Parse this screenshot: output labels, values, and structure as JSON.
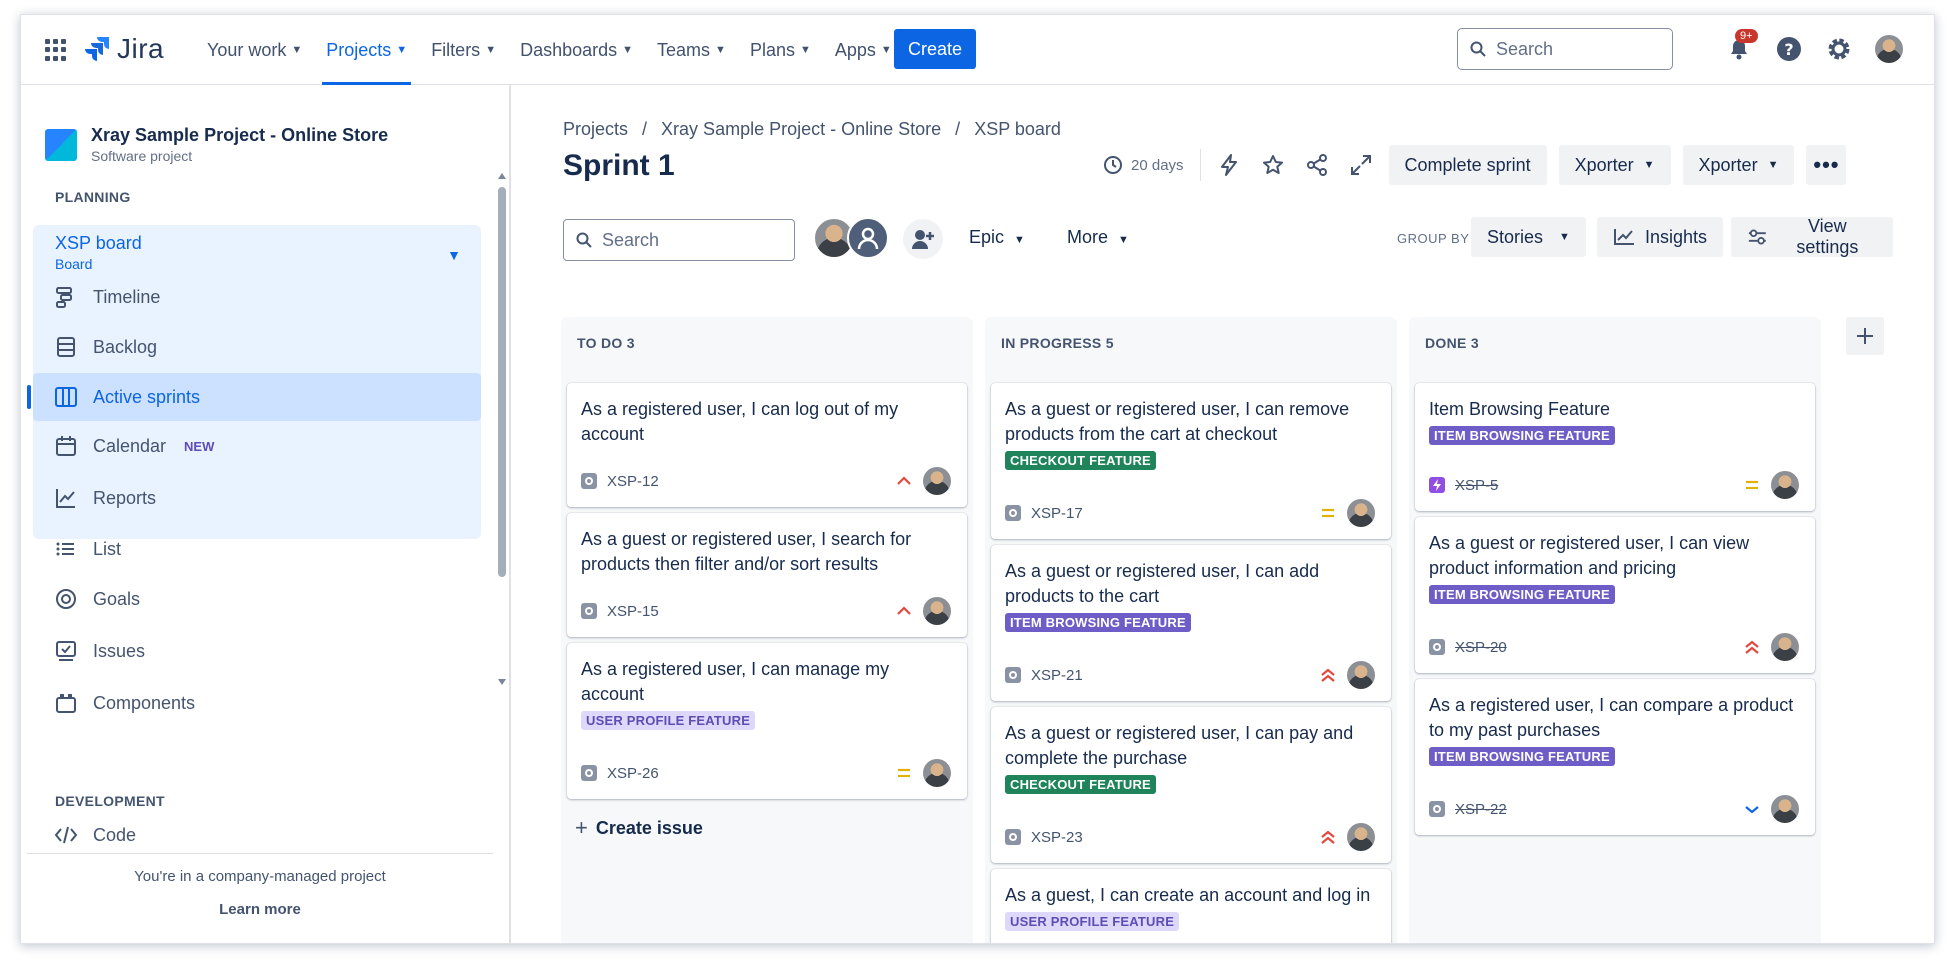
{
  "nav": {
    "logo_text": "Jira",
    "items": [
      {
        "label": "Your work"
      },
      {
        "label": "Projects"
      },
      {
        "label": "Filters"
      },
      {
        "label": "Dashboards"
      },
      {
        "label": "Teams"
      },
      {
        "label": "Plans"
      },
      {
        "label": "Apps"
      }
    ],
    "active_item": "Projects",
    "create_label": "Create",
    "search_placeholder": "Search",
    "notifications_badge": "9+"
  },
  "sidebar": {
    "project_name": "Xray Sample Project - Online Store",
    "project_type": "Software project",
    "planning_label": "PLANNING",
    "board": {
      "title": "XSP board",
      "subtitle": "Board"
    },
    "planning_items": [
      {
        "label": "Timeline",
        "icon": "timeline-icon"
      },
      {
        "label": "Backlog",
        "icon": "backlog-icon"
      },
      {
        "label": "Active sprints",
        "icon": "board-columns-icon",
        "active": true
      },
      {
        "label": "Calendar",
        "icon": "calendar-icon",
        "badge": "NEW"
      },
      {
        "label": "Reports",
        "icon": "reports-icon"
      }
    ],
    "other_items": [
      {
        "label": "List",
        "icon": "list-icon"
      },
      {
        "label": "Goals",
        "icon": "goals-icon"
      },
      {
        "label": "Issues",
        "icon": "issues-icon"
      },
      {
        "label": "Components",
        "icon": "components-icon"
      }
    ],
    "development_label": "DEVELOPMENT",
    "development_items": [
      {
        "label": "Code",
        "icon": "code-icon"
      }
    ],
    "footer_text": "You're in a company-managed project",
    "footer_link": "Learn more"
  },
  "board": {
    "breadcrumb": [
      "Projects",
      "Xray Sample Project - Online Store",
      "XSP board"
    ],
    "breadcrumb_sep": "/",
    "title": "Sprint 1",
    "days_left": "20 days",
    "complete_sprint": "Complete sprint",
    "xporter_1": "Xporter",
    "xporter_2": "Xporter",
    "search_placeholder": "Search",
    "epic_label": "Epic",
    "more_label": "More",
    "group_by_label": "GROUP BY",
    "group_by_value": "Stories",
    "insights_label": "Insights",
    "view_settings_label": "View settings",
    "create_issue_label": "Create issue",
    "columns": [
      {
        "title": "TO DO 3",
        "cards": [
          {
            "title": "As a registered user, I can log out of my account",
            "key": "XSP-12",
            "priority": "medium-high"
          },
          {
            "title": "As a guest or registered user, I search for products then filter and/or sort results",
            "key": "XSP-15",
            "priority": "medium-high"
          },
          {
            "title": "As a registered user, I can manage my account",
            "label": "USER PROFILE FEATURE",
            "label_style": "light",
            "key": "XSP-26",
            "priority": "medium"
          }
        ]
      },
      {
        "title": "IN PROGRESS 5",
        "cards": [
          {
            "title": "As a guest or registered user, I can remove products from the cart at checkout",
            "label": "CHECKOUT FEATURE",
            "label_style": "green",
            "key": "XSP-17",
            "priority": "medium"
          },
          {
            "title": "As a guest or registered user, I can add products to the cart",
            "label": "ITEM BROWSING FEATURE",
            "label_style": "purple",
            "key": "XSP-21",
            "priority": "high"
          },
          {
            "title": "As a guest or registered user, I can pay and complete the purchase",
            "label": "CHECKOUT FEATURE",
            "label_style": "green",
            "key": "XSP-23",
            "priority": "high"
          },
          {
            "title": "As a guest, I can create an account and log in",
            "label": "USER PROFILE FEATURE",
            "label_style": "light",
            "key": "",
            "priority": ""
          }
        ]
      },
      {
        "title": "DONE 3",
        "cards": [
          {
            "title": "Item Browsing Feature",
            "label": "ITEM BROWSING FEATURE",
            "label_style": "purple",
            "key": "XSP-5",
            "type": "epic",
            "priority": "medium"
          },
          {
            "title": "As a guest or registered user, I can view product information and pricing",
            "label": "ITEM BROWSING FEATURE",
            "label_style": "purple",
            "key": "XSP-20",
            "priority": "high"
          },
          {
            "title": "As a registered user, I can compare a product to my past purchases",
            "label": "ITEM BROWSING FEATURE",
            "label_style": "purple",
            "key": "XSP-22",
            "priority": "low"
          }
        ]
      }
    ]
  },
  "colors": {
    "accent": "#0c66e4",
    "priority_high": "#e2483d",
    "priority_medium": "#e2b203",
    "priority_low": "#0c66e4"
  }
}
